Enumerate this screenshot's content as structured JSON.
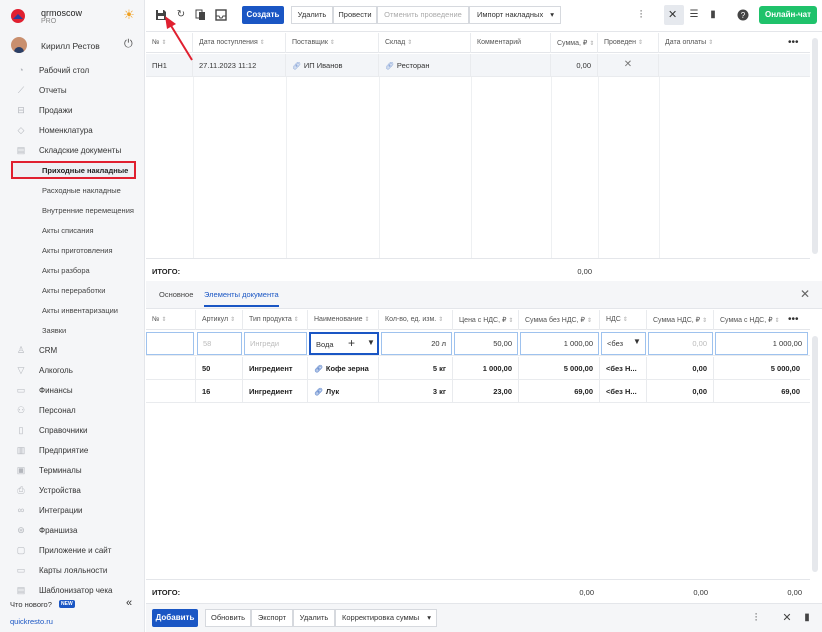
{
  "brand": {
    "name": "qrmoscow",
    "plan": "PRO"
  },
  "user": {
    "name": "Кирилл Рестов"
  },
  "nav": [
    {
      "label": "Рабочий стол",
      "icon": "dashboard-icon"
    },
    {
      "label": "Отчеты",
      "icon": "chart-icon"
    },
    {
      "label": "Продажи",
      "icon": "cart-icon"
    },
    {
      "label": "Номенклатура",
      "icon": "tag-icon"
    },
    {
      "label": "Складские документы",
      "icon": "warehouse-icon"
    }
  ],
  "subnav": [
    "Приходные накладные",
    "Расходные накладные",
    "Внутренние перемещения",
    "Акты списания",
    "Акты приготовления",
    "Акты разбора",
    "Акты переработки",
    "Акты инвентаризации",
    "Заявки"
  ],
  "nav2": [
    {
      "label": "CRM",
      "icon": "crm-icon"
    },
    {
      "label": "Алкоголь",
      "icon": "glass-icon"
    },
    {
      "label": "Финансы",
      "icon": "finance-icon"
    },
    {
      "label": "Персонал",
      "icon": "people-icon"
    },
    {
      "label": "Справочники",
      "icon": "book-icon"
    },
    {
      "label": "Предприятие",
      "icon": "building-icon"
    },
    {
      "label": "Терминалы",
      "icon": "terminal-icon"
    },
    {
      "label": "Устройства",
      "icon": "printer-icon"
    },
    {
      "label": "Интеграции",
      "icon": "integration-icon"
    },
    {
      "label": "Франшиза",
      "icon": "franchise-icon"
    },
    {
      "label": "Приложение и сайт",
      "icon": "app-icon"
    },
    {
      "label": "Карты лояльности",
      "icon": "card-icon"
    },
    {
      "label": "Шаблонизатор чека",
      "icon": "receipt-icon"
    }
  ],
  "sidebar_bottom": {
    "whats_new": "Что нового?",
    "badge": "NEW",
    "site": "quickresto.ru"
  },
  "toolbar": {
    "create": "Создать",
    "delete": "Удалить",
    "conduct": "Провести",
    "cancel_conduct": "Отменить проведение",
    "import": "Импорт накладных",
    "chat": "Онлайн-чат"
  },
  "invoices": {
    "columns": [
      "№",
      "Дата поступления",
      "Поставщик",
      "Склад",
      "Комментарий",
      "Сумма, ₽",
      "Проведен",
      "Дата оплаты"
    ],
    "rows": [
      {
        "num": "ПН1",
        "date": "27.11.2023 11:12",
        "supplier": "ИП Иванов",
        "warehouse": "Ресторан",
        "comment": "",
        "sum": "0,00",
        "conducted": "✕",
        "paydate": ""
      }
    ],
    "total_label": "ИТОГО:",
    "total_sum": "0,00"
  },
  "tabs": {
    "main": "Основное",
    "elements": "Элементы документа"
  },
  "elements": {
    "columns": [
      "№",
      "Артикул",
      "Тип продукта",
      "Наименование",
      "Кол-во, ед. изм.",
      "Цена с НДС, ₽",
      "Сумма без НДС, ₽",
      "НДС",
      "Сумма НДС, ₽",
      "Сумма с НДС, ₽"
    ],
    "edit_row": {
      "article": "58",
      "type": "Ингреди",
      "name": "Вода",
      "qty": "20 л",
      "price": "50,00",
      "sum_no_vat": "1 000,00",
      "vat": "<без",
      "vat_sum": "0,00",
      "sum_vat": "1 000,00"
    },
    "rows": [
      {
        "article": "50",
        "type": "Ингредиент",
        "name": "Кофе зерна",
        "qty": "5 кг",
        "price": "1 000,00",
        "sum_no_vat": "5 000,00",
        "vat": "<без Н...",
        "vat_sum": "0,00",
        "sum_vat": "5 000,00"
      },
      {
        "article": "16",
        "type": "Ингредиент",
        "name": "Лук",
        "qty": "3 кг",
        "price": "23,00",
        "sum_no_vat": "69,00",
        "vat": "<без Н...",
        "vat_sum": "0,00",
        "sum_vat": "69,00"
      }
    ],
    "total_label": "ИТОГО:",
    "total_sum_no_vat": "0,00",
    "total_vat_sum": "0,00",
    "total_sum_vat": "0,00"
  },
  "bottombar": {
    "add": "Добавить",
    "refresh": "Обновить",
    "export": "Экспорт",
    "delete": "Удалить",
    "adjust": "Корректировка суммы"
  },
  "colors": {
    "primary": "#1a56c4",
    "green": "#1fc26b",
    "highlight": "#e02030"
  }
}
